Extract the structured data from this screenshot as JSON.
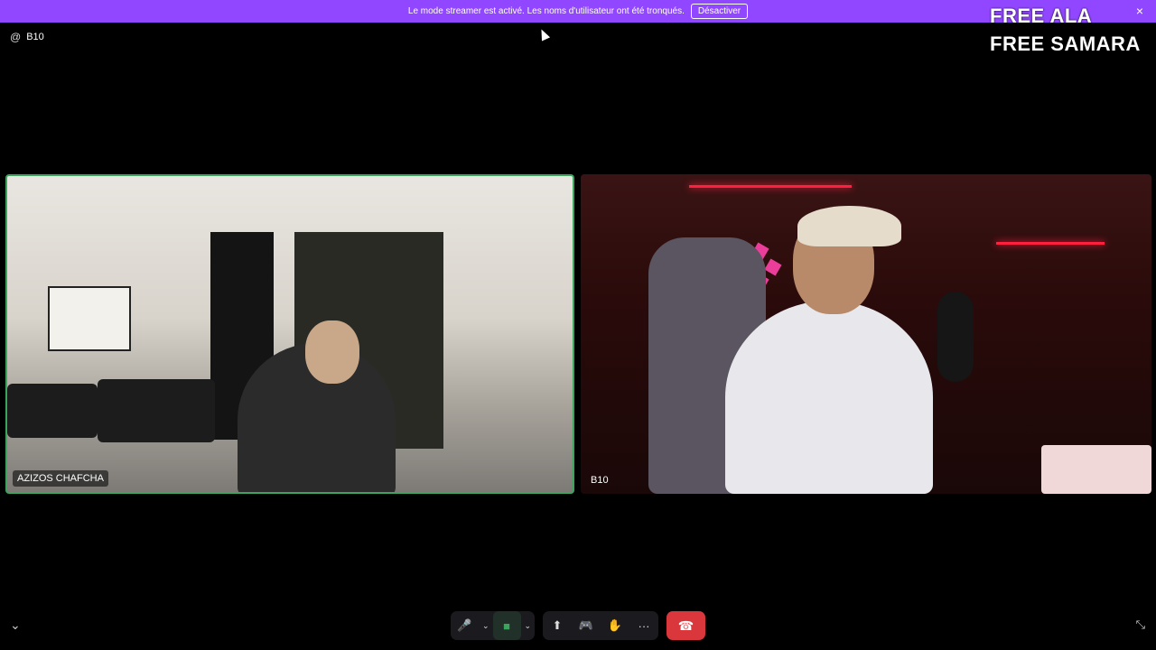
{
  "banner": {
    "message": "Le mode streamer est activé. Les noms d'utilisateur ont été tronqués.",
    "disable_label": "Désactiver",
    "close_icon": "×"
  },
  "overlay": {
    "line1": "FREE ALA",
    "line2": "FREE SAMARA"
  },
  "channel": {
    "at_icon": "@",
    "name": "B10"
  },
  "tiles": [
    {
      "label": "AZIZOS CHAFCHA",
      "speaking": true
    },
    {
      "label": "B10",
      "speaking": false
    }
  ],
  "controls": {
    "mic_icon": "🎤",
    "camera_icon": "■",
    "share_screen_icon": "⬆",
    "activity_icon": "🎮",
    "soundboard_icon": "✋",
    "more_icon": "···",
    "hangup_icon": "☎",
    "chevron": "⌄"
  },
  "colors": {
    "banner": "#9147ff",
    "speaking_border": "#3ba55d",
    "hangup": "#da373c"
  }
}
